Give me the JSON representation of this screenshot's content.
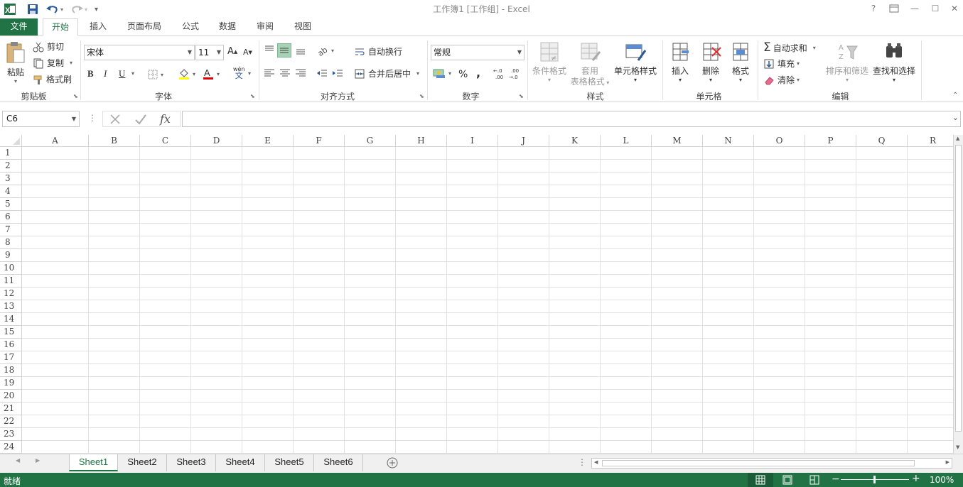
{
  "window": {
    "title": "工作簿1  [工作组] - Excel",
    "help": "?",
    "min": "—",
    "max": "☐",
    "close": "✕"
  },
  "tabs": [
    "文件",
    "开始",
    "插入",
    "页面布局",
    "公式",
    "数据",
    "审阅",
    "视图"
  ],
  "ribbon": {
    "clipboard": {
      "label": "剪贴板",
      "paste": "粘贴",
      "cut": "剪切",
      "copy": "复制",
      "format_painter": "格式刷"
    },
    "font": {
      "label": "字体",
      "name": "宋体",
      "size": "11",
      "bold": "B",
      "italic": "I",
      "underline": "U",
      "wen": "wén",
      "wen2": "文"
    },
    "alignment": {
      "label": "对齐方式",
      "wrap": "自动换行",
      "merge": "合并后居中"
    },
    "number": {
      "label": "数字",
      "format": "常规",
      "percent": "%",
      "comma": ",",
      "inc": "←.0\n.00",
      "dec": ".00\n→.0"
    },
    "styles": {
      "label": "样式",
      "conditional": "条件格式",
      "table_line1": "套用",
      "table_line2": "表格格式",
      "cell_styles": "单元格样式"
    },
    "cells": {
      "label": "单元格",
      "insert": "插入",
      "delete": "删除",
      "format": "格式"
    },
    "editing": {
      "label": "编辑",
      "autosum": "自动求和",
      "fill": "填充",
      "clear": "清除",
      "sort": "排序和筛选",
      "find": "查找和选择"
    }
  },
  "formula_bar": {
    "name_box": "C6",
    "fx": "fx",
    "value": ""
  },
  "columns": [
    "A",
    "B",
    "C",
    "D",
    "E",
    "F",
    "G",
    "H",
    "I",
    "J",
    "K",
    "L",
    "M",
    "N",
    "O",
    "P",
    "Q",
    "R"
  ],
  "rows": [
    "1",
    "2",
    "3",
    "4",
    "5",
    "6",
    "7",
    "8",
    "9",
    "10",
    "11",
    "12",
    "13",
    "14",
    "15",
    "16",
    "17",
    "18",
    "19",
    "20",
    "21",
    "22",
    "23",
    "24"
  ],
  "sheets": [
    "Sheet1",
    "Sheet2",
    "Sheet3",
    "Sheet4",
    "Sheet5",
    "Sheet6"
  ],
  "active_sheet": "Sheet1",
  "status": {
    "ready": "就绪",
    "zoom": "100%"
  },
  "colors": {
    "accent": "#217346"
  }
}
